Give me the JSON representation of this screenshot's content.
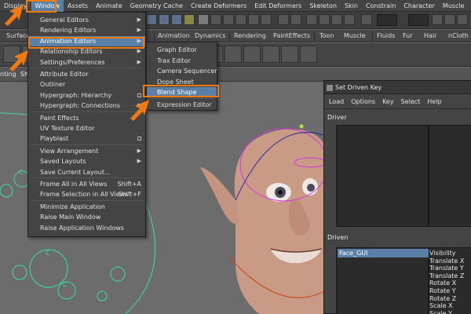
{
  "menubar": {
    "items": [
      "Display",
      "Window",
      "Assets",
      "Animate",
      "Geometry Cache",
      "Create Deformers",
      "Edit Deformers",
      "Skeleton",
      "Skin",
      "Constrain",
      "Character",
      "Muscle",
      "Help"
    ],
    "active": "Window"
  },
  "shelf": {
    "tabs": [
      "Surfaces",
      "Animation",
      "Dynamics",
      "Rendering",
      "PaintEffects",
      "Toon",
      "Muscle",
      "Fluids",
      "Fur",
      "Hair",
      "nCloth"
    ]
  },
  "panelbar": {
    "left_label": "nting",
    "right_label": "Sh"
  },
  "window_menu": {
    "items": [
      {
        "label": "General Editors",
        "type": "submenu"
      },
      {
        "label": "Rendering Editors",
        "type": "submenu"
      },
      {
        "label": "Animation Editors",
        "type": "submenu",
        "highlighted": true
      },
      {
        "label": "Relationship Editors",
        "type": "submenu"
      },
      {
        "label": "Settings/Preferences",
        "type": "submenu"
      },
      {
        "label": "Attribute Editor",
        "type": "item"
      },
      {
        "label": "Outliner",
        "type": "item"
      },
      {
        "label": "Hypergraph: Hierarchy",
        "type": "option"
      },
      {
        "label": "Hypergraph: Connections",
        "type": "option"
      },
      {
        "label": "Paint Effects",
        "type": "item"
      },
      {
        "label": "UV Texture Editor",
        "type": "item"
      },
      {
        "label": "Playblast",
        "type": "option"
      },
      {
        "label": "View Arrangement",
        "type": "submenu"
      },
      {
        "label": "Saved Layouts",
        "type": "submenu"
      },
      {
        "label": "Save Current Layout...",
        "type": "item"
      },
      {
        "label": "Frame All in All Views",
        "type": "item",
        "shortcut": "Shift+A"
      },
      {
        "label": "Frame Selection in All Views",
        "type": "item",
        "shortcut": "Shift+F"
      },
      {
        "label": "Minimize Application",
        "type": "item"
      },
      {
        "label": "Raise Main Window",
        "type": "item"
      },
      {
        "label": "Raise Application Windows",
        "type": "item"
      }
    ]
  },
  "animation_submenu": {
    "items": [
      {
        "label": "Graph Editor"
      },
      {
        "label": "Trax Editor"
      },
      {
        "label": "Camera Sequencer"
      },
      {
        "label": "Dope Sheet"
      },
      {
        "label": "Blend Shape",
        "highlighted": true
      },
      {
        "label": "Expression Editor"
      }
    ]
  },
  "set_driven_key": {
    "title": "Set Driven Key",
    "menus": [
      "Load",
      "Options",
      "Key",
      "Select",
      "Help"
    ],
    "driver_label": "Driver",
    "driven_label": "Driven",
    "driven_object": "Face_GUI",
    "driven_attributes": [
      "Visibility",
      "Translate X",
      "Translate Y",
      "Translate Z",
      "Rotate X",
      "Rotate Y",
      "Rotate Z",
      "Scale X",
      "Scale Y"
    ]
  },
  "colors": {
    "accent": "#f07a12",
    "selection": "#5a80a8",
    "curve_green": "#3fd9a5",
    "curve_magenta": "#d23ad6"
  },
  "icons": [
    "window-icon",
    "arrow-pointer-icon",
    "chevron-right-icon",
    "option-box-icon"
  ]
}
